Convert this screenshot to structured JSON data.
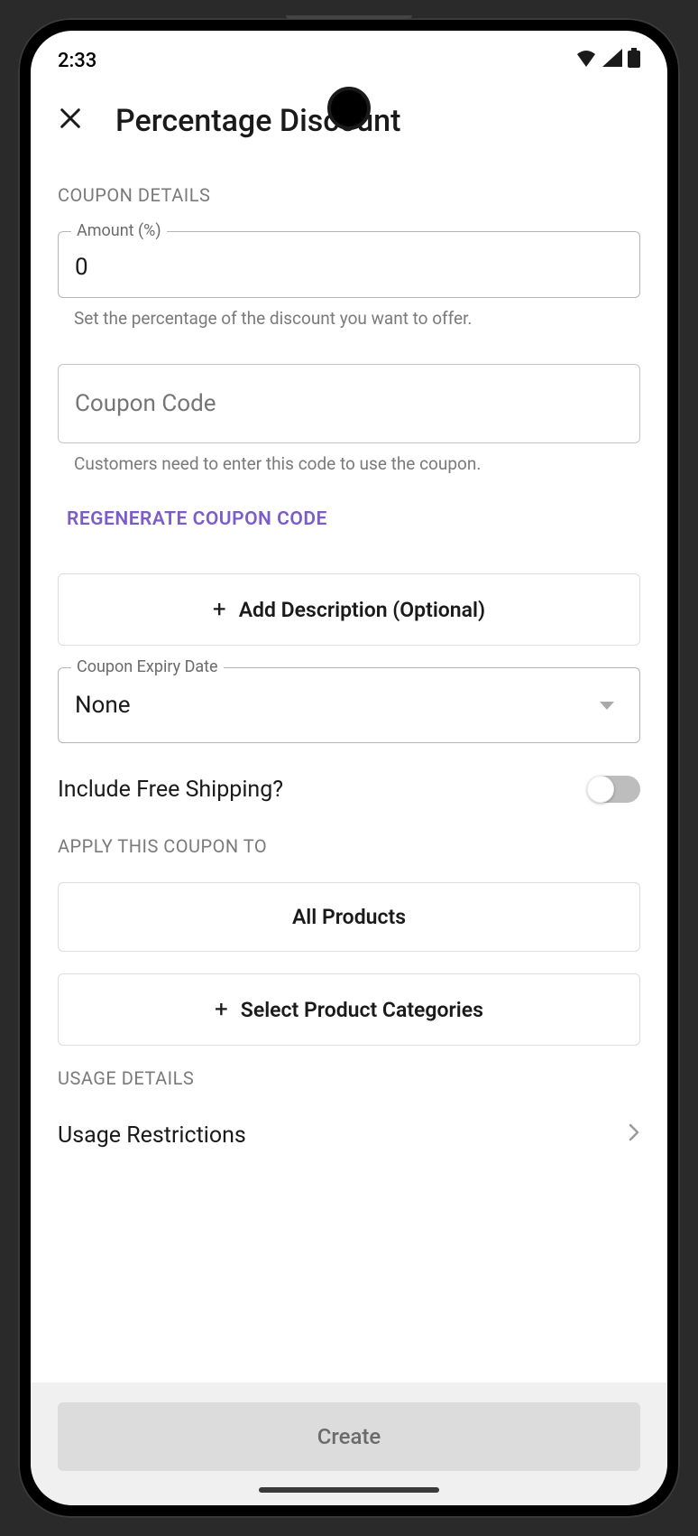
{
  "status": {
    "time": "2:33"
  },
  "header": {
    "title": "Percentage Discount"
  },
  "sections": {
    "coupon_details_label": "COUPON DETAILS",
    "apply_to_label": "APPLY THIS COUPON TO",
    "usage_details_label": "USAGE DETAILS"
  },
  "fields": {
    "amount": {
      "label": "Amount (%)",
      "value": "0",
      "helper": "Set the percentage of the discount you want to offer."
    },
    "code": {
      "placeholder": "Coupon Code",
      "helper": "Customers need to enter this code to use the coupon."
    },
    "expiry": {
      "label": "Coupon Expiry Date",
      "value": "None"
    }
  },
  "buttons": {
    "regenerate": "REGENERATE COUPON CODE",
    "add_description": "Add Description (Optional)",
    "all_products": "All Products",
    "select_categories": "Select Product Categories",
    "create": "Create"
  },
  "toggles": {
    "free_shipping": {
      "label": "Include Free Shipping?"
    }
  },
  "nav": {
    "usage_restrictions": "Usage Restrictions"
  }
}
